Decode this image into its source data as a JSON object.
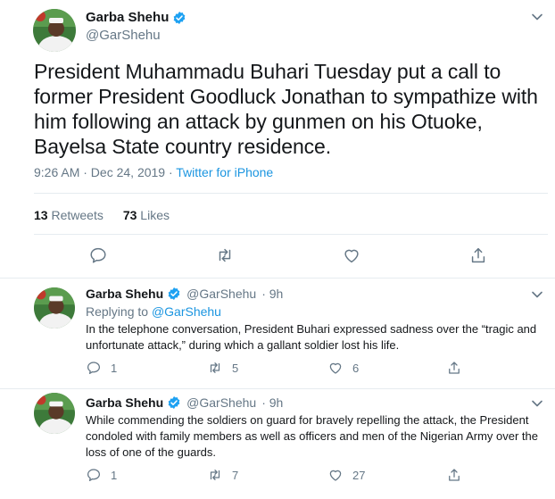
{
  "main": {
    "author_name": "Garba Shehu",
    "author_handle": "@GarShehu",
    "text": "President Muhammadu Buhari Tuesday put a call to former President Goodluck Jonathan to sympathize with him following an attack by gunmen on his Otuoke, Bayelsa State country residence.",
    "time": "9:26 AM · Dec 24, 2019 · ",
    "source": "Twitter for iPhone",
    "retweets_count": "13",
    "retweets_label": "Retweets",
    "likes_count": "73",
    "likes_label": "Likes"
  },
  "replies": [
    {
      "author_name": "Garba Shehu",
      "author_handle": "@GarShehu",
      "age": "· 9h",
      "replying_prefix": "Replying to ",
      "replying_to": "@GarShehu",
      "text": "In the telephone conversation, President Buhari expressed sadness over the “tragic and unfortunate attack,” during which a gallant soldier lost his life.",
      "reply_count": "1",
      "retweet_count": "5",
      "like_count": "6"
    },
    {
      "author_name": "Garba Shehu",
      "author_handle": "@GarShehu",
      "age": "· 9h",
      "text": "While commending the soldiers on guard for bravely repelling the attack, the President condoled with family members as well as officers and men of the Nigerian Army over the loss of one of the guards.",
      "reply_count": "1",
      "retweet_count": "7",
      "like_count": "27"
    }
  ],
  "colors": {
    "link": "#1b95e0",
    "muted": "#657786",
    "text": "#14171a",
    "verified": "#1da1f2"
  }
}
